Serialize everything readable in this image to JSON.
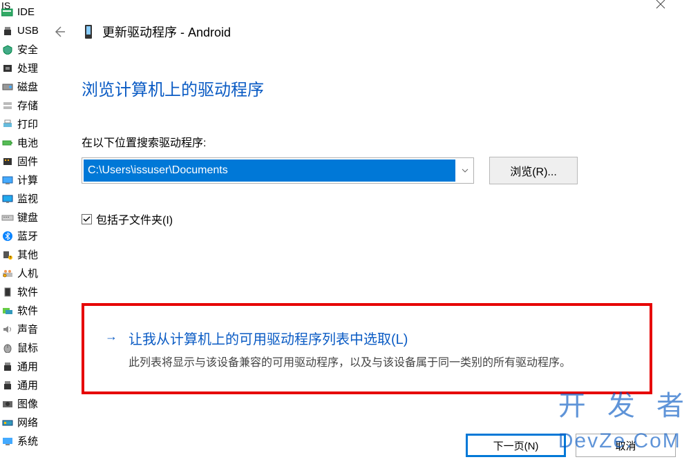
{
  "sidebar": {
    "items": [
      {
        "label": "IDE",
        "icon": "ide-icon"
      },
      {
        "label": "USB",
        "icon": "usb-icon"
      },
      {
        "label": "安全",
        "icon": "security-icon"
      },
      {
        "label": "处理",
        "icon": "cpu-icon"
      },
      {
        "label": "磁盘",
        "icon": "disk-icon"
      },
      {
        "label": "存储",
        "icon": "storage-icon"
      },
      {
        "label": "打印",
        "icon": "printer-icon"
      },
      {
        "label": "电池",
        "icon": "battery-icon"
      },
      {
        "label": "固件",
        "icon": "firmware-icon"
      },
      {
        "label": "计算",
        "icon": "computer-icon"
      },
      {
        "label": "监视",
        "icon": "monitor-icon"
      },
      {
        "label": "键盘",
        "icon": "keyboard-icon"
      },
      {
        "label": "蓝牙",
        "icon": "bluetooth-icon"
      },
      {
        "label": "其他",
        "icon": "other-icon"
      },
      {
        "label": "人机",
        "icon": "hid-icon"
      },
      {
        "label": "软件",
        "icon": "software-icon"
      },
      {
        "label": "软件",
        "icon": "software2-icon"
      },
      {
        "label": "声音",
        "icon": "sound-icon"
      },
      {
        "label": "鼠标",
        "icon": "mouse-icon"
      },
      {
        "label": "通用",
        "icon": "generic-icon"
      },
      {
        "label": "通用",
        "icon": "generic2-icon"
      },
      {
        "label": "图像",
        "icon": "image-icon"
      },
      {
        "label": "网络",
        "icon": "network-icon"
      },
      {
        "label": "系统",
        "icon": "system-icon"
      }
    ]
  },
  "dialog": {
    "title": "更新驱动程序 - Android",
    "section_title": "浏览计算机上的驱动程序",
    "search_label": "在以下位置搜索驱动程序:",
    "path_value": "C:\\Users\\issuser\\Documents",
    "browse_label": "浏览(R)...",
    "checkbox_label": "包括子文件夹(I)",
    "checkbox_checked": true,
    "pick_title": "让我从计算机上的可用驱动程序列表中选取(L)",
    "pick_desc": "此列表将显示与该设备兼容的可用驱动程序，以及与该设备属于同一类别的所有驱动程序。",
    "next_label": "下一页(N)",
    "cancel_label": "取消"
  },
  "watermark": "开 发 者DevZe.CoM"
}
